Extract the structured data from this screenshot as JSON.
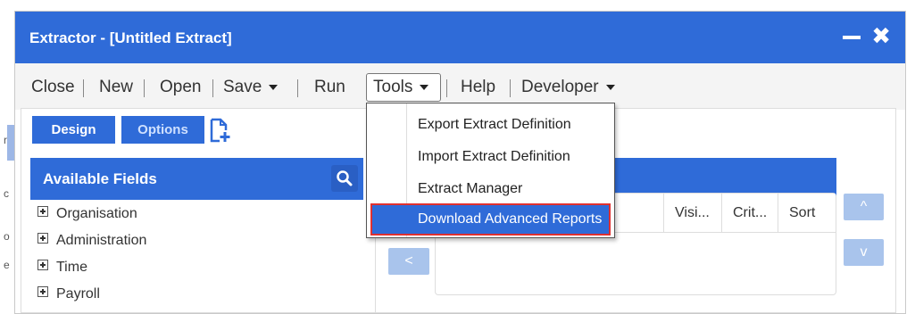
{
  "window": {
    "title": "Extractor - [Untitled Extract]"
  },
  "menubar": {
    "items": [
      "Close",
      "New",
      "Open",
      "Save",
      "Run",
      "Tools",
      "Help",
      "Developer"
    ]
  },
  "tools_menu": {
    "items": [
      "Export Extract Definition",
      "Import Extract Definition",
      "Extract Manager",
      "Download Advanced Reports"
    ],
    "highlighted_index": 3
  },
  "tabs": {
    "design": "Design",
    "options": "Options"
  },
  "fields_panel": {
    "title": "Available Fields",
    "items": [
      "Organisation",
      "Administration",
      "Time",
      "Payroll"
    ]
  },
  "grid": {
    "columns": [
      "Visi...",
      "Crit...",
      "Sort"
    ]
  },
  "buttons": {
    "move_left": "<",
    "move_up": "^",
    "move_down": "v"
  },
  "colors": {
    "title_bar": "#2f6bd8",
    "menubar_bg": "#f4f4f4",
    "highlight": "#2f6bd8",
    "highlight_border": "#e03030",
    "arrow_button": "#a9c4ec"
  },
  "icons": [
    "minimize-icon",
    "close-icon",
    "caret-down-icon",
    "add-page-icon",
    "search-icon",
    "plus-box-icon"
  ]
}
